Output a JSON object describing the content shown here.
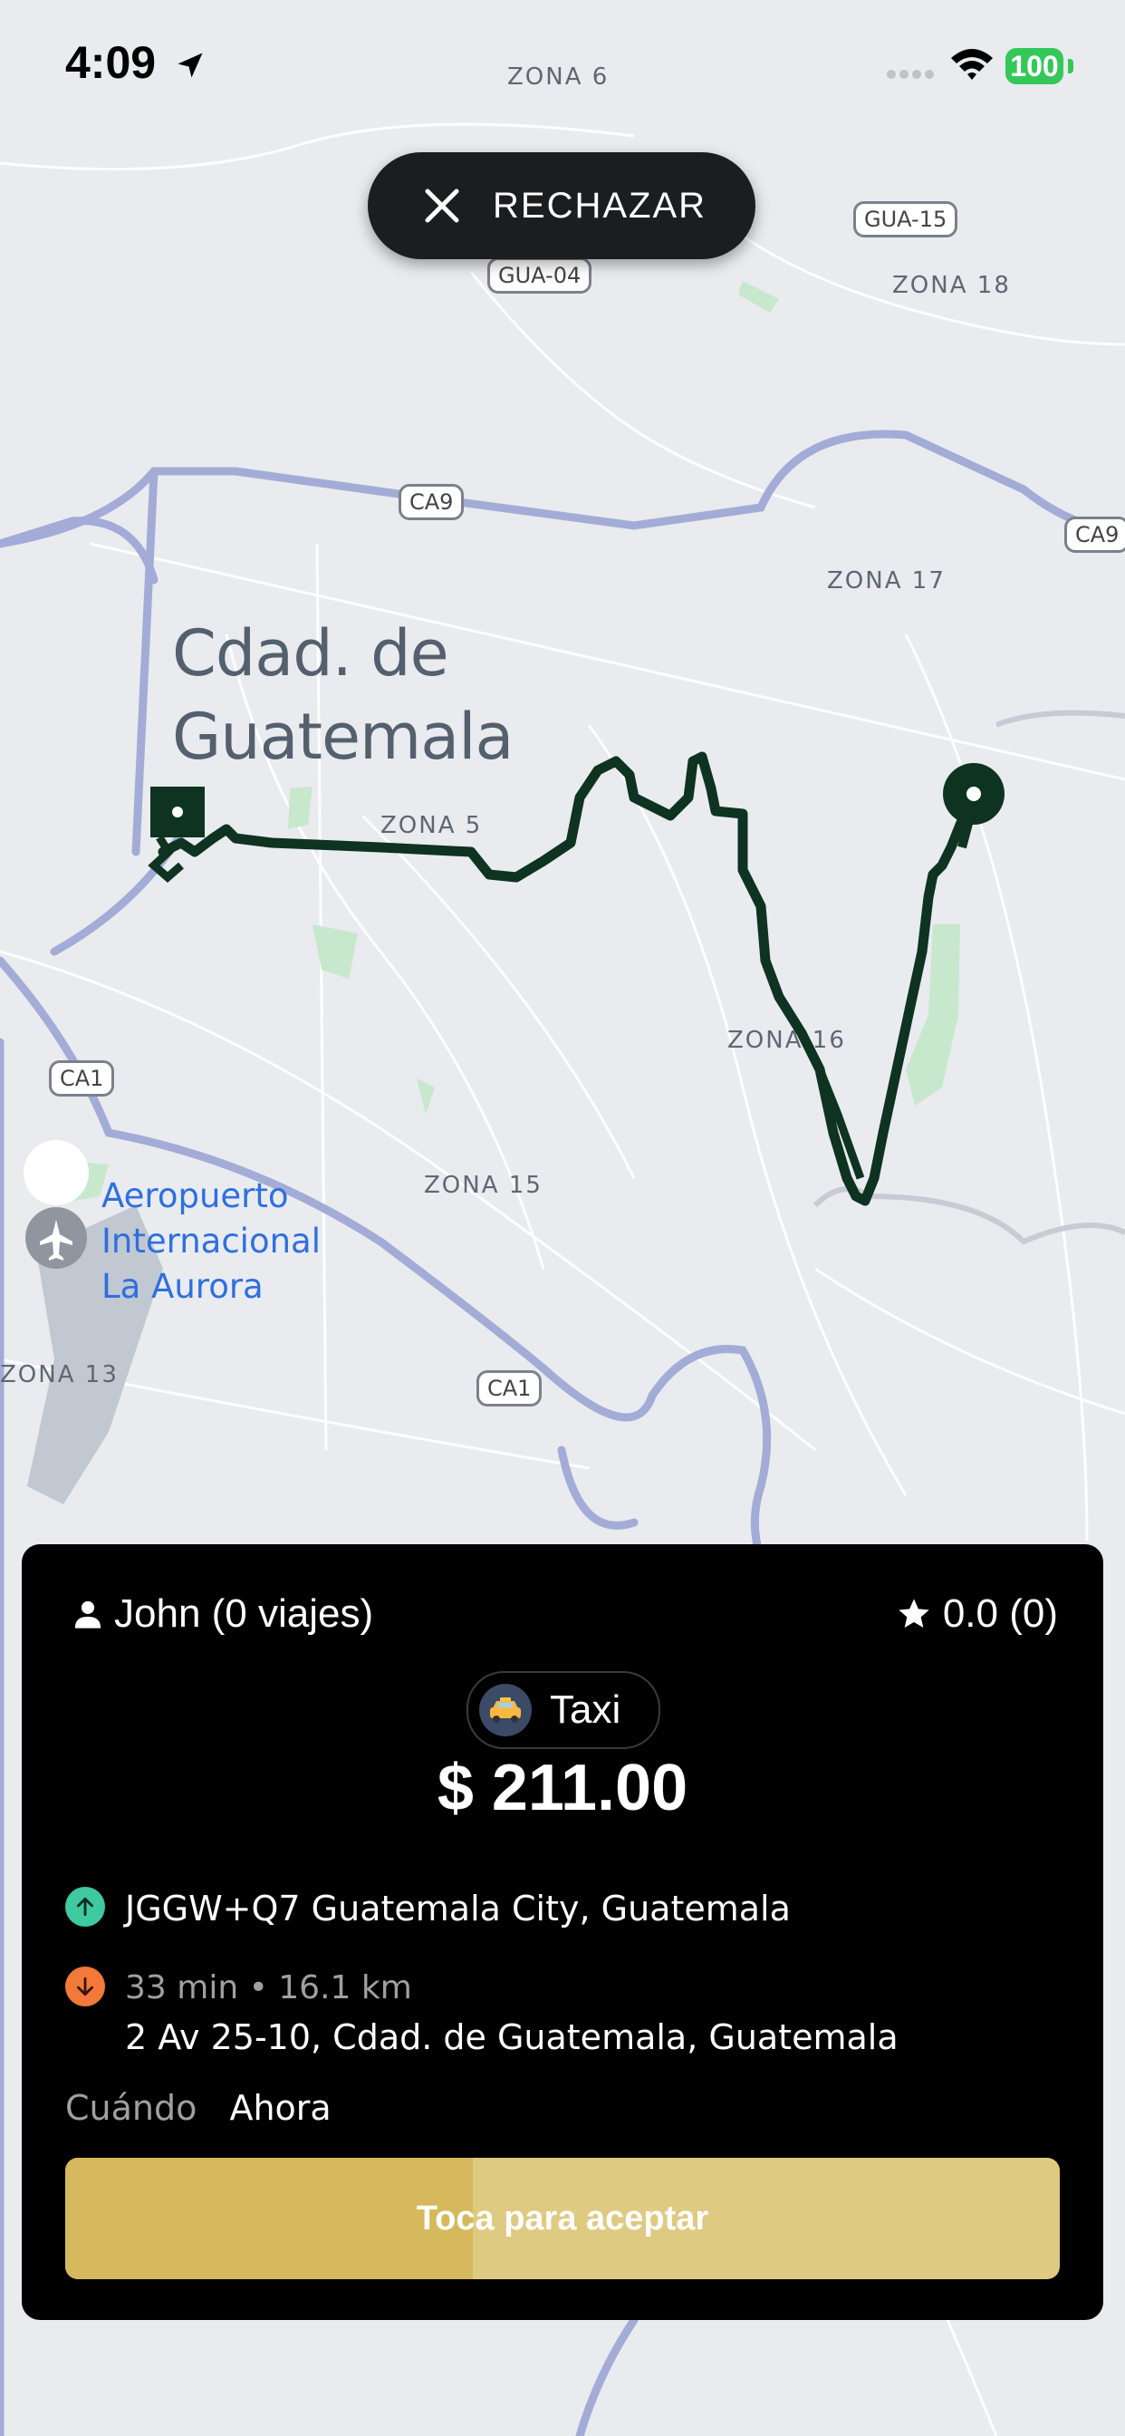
{
  "status_bar": {
    "time": "4:09",
    "battery": "100",
    "icons": [
      "location-arrow-icon",
      "signal-dots-icon",
      "wifi-icon",
      "battery-icon"
    ]
  },
  "reject_button": {
    "label": "RECHAZAR",
    "icon": "close-icon"
  },
  "map": {
    "city": "Cdad. de\nGuatemala",
    "zones": [
      "ZONA 6",
      "ZONA 18",
      "ZONA 17",
      "ZONA 5",
      "ZONA 16",
      "ZONA 15",
      "ZONA 13"
    ],
    "road_shields": [
      "GUA-15",
      "GUA-04",
      "CA9",
      "CA9",
      "CA1",
      "CA1"
    ],
    "airport": "Aeropuerto\nInternacional\nLa Aurora",
    "route_color": "#0e3321"
  },
  "trip_card": {
    "rider": "John (0 viajes)",
    "rating": "0.0 (0)",
    "service": "Taxi",
    "fare": "$ 211.00",
    "pickup": {
      "address": "JGGW+Q7 Guatemala City, Guatemala",
      "color": "#3ec9a0"
    },
    "dropoff": {
      "eta": "33 min • 16.1 km",
      "address": "2 Av 25-10, Cdad. de Guatemala, Guatemala",
      "color": "#f2793a"
    },
    "when_label": "Cuándo",
    "when_value": "Ahora",
    "accept_label": "Toca para aceptar",
    "accept_progress": 0.41,
    "accent": "#d6b95c"
  }
}
